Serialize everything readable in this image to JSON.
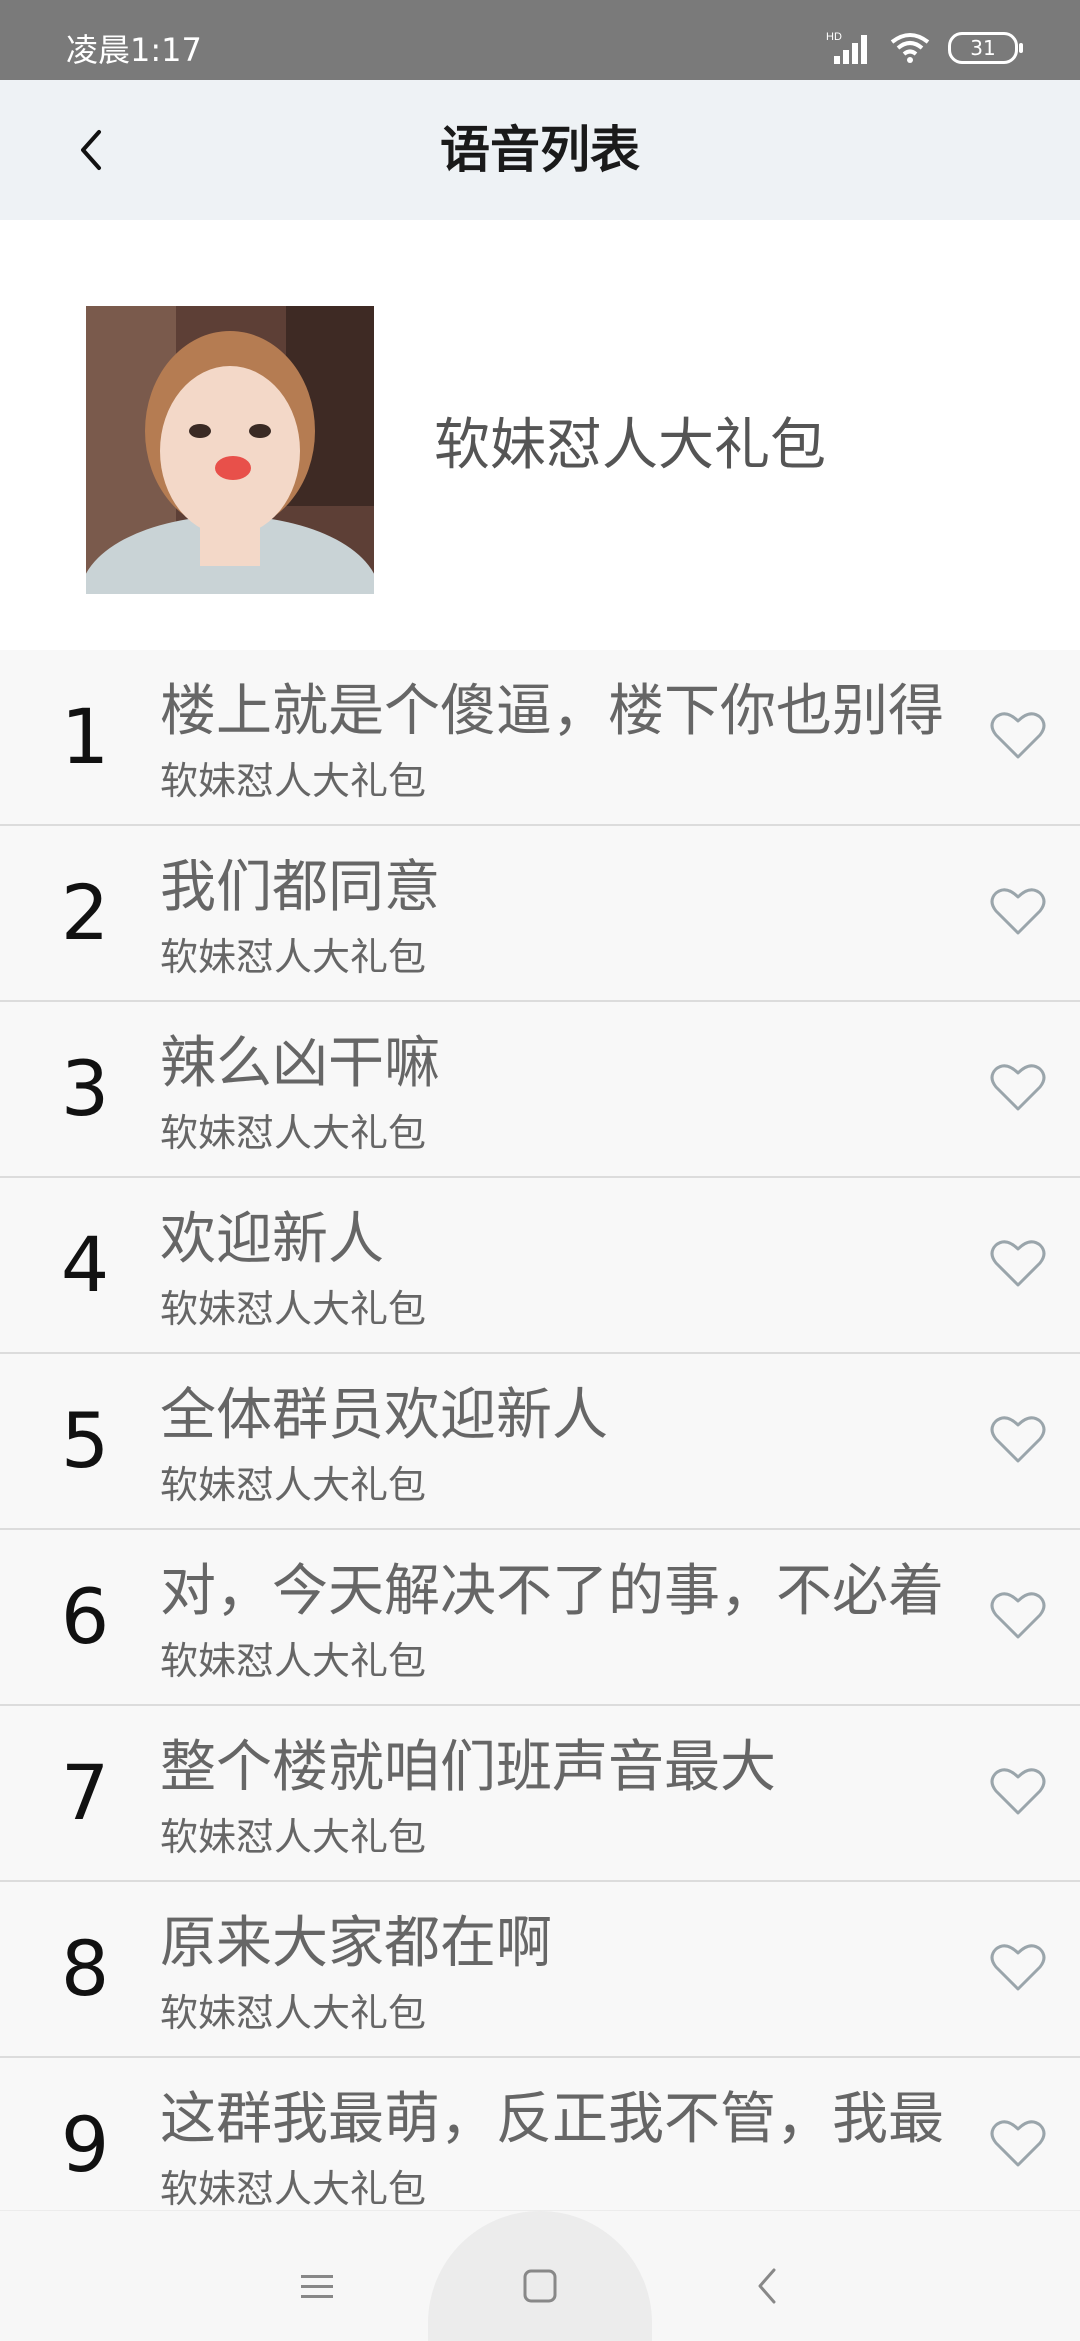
{
  "status_bar": {
    "time": "凌晨1:17",
    "battery": "31",
    "network_label": "HD"
  },
  "header": {
    "title": "语音列表"
  },
  "album": {
    "name": "软妹怼人大礼包"
  },
  "items": [
    {
      "number": "1",
      "title": "楼上就是个傻逼，楼下你也别得",
      "subtitle": "软妹怼人大礼包"
    },
    {
      "number": "2",
      "title": "我们都同意",
      "subtitle": "软妹怼人大礼包"
    },
    {
      "number": "3",
      "title": "辣么凶干嘛",
      "subtitle": "软妹怼人大礼包"
    },
    {
      "number": "4",
      "title": "欢迎新人",
      "subtitle": "软妹怼人大礼包"
    },
    {
      "number": "5",
      "title": "全体群员欢迎新人",
      "subtitle": "软妹怼人大礼包"
    },
    {
      "number": "6",
      "title": "对，今天解决不了的事，不必着",
      "subtitle": "软妹怼人大礼包"
    },
    {
      "number": "7",
      "title": "整个楼就咱们班声音最大",
      "subtitle": "软妹怼人大礼包"
    },
    {
      "number": "8",
      "title": "原来大家都在啊",
      "subtitle": "软妹怼人大礼包"
    },
    {
      "number": "9",
      "title": "这群我最萌，反正我不管，我最",
      "subtitle": "软妹怼人大礼包"
    }
  ],
  "icons": {
    "back": "chevron-left-icon",
    "favorite": "heart-outline-icon",
    "nav_menu": "menu-icon",
    "nav_home": "square-icon",
    "nav_back": "triangle-back-icon"
  },
  "colors": {
    "header_bg": "#eef2f5",
    "row_bg": "#f8f8f8",
    "heart": "#9aa5ab",
    "status_bar": "#7a7a7a"
  }
}
